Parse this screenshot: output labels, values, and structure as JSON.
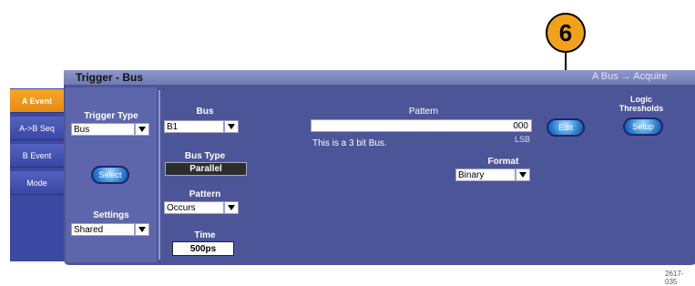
{
  "callout": {
    "number": "6"
  },
  "window": {
    "title": "Trigger - Bus",
    "right_info": "A Bus → Acquire"
  },
  "sidebar": {
    "tabs": [
      {
        "label": "A Event",
        "active": true
      },
      {
        "label": "A->B Seq",
        "active": false
      },
      {
        "label": "B Event",
        "active": false
      },
      {
        "label": "Mode",
        "active": false
      }
    ]
  },
  "trigger_type": {
    "label": "Trigger Type",
    "value": "Bus"
  },
  "select_button": {
    "label": "Select"
  },
  "settings": {
    "label": "Settings",
    "value": "Shared"
  },
  "bus": {
    "label": "Bus",
    "value": "B1"
  },
  "bus_type": {
    "label": "Bus Type",
    "value": "Parallel"
  },
  "pattern_mode": {
    "label": "Pattern",
    "value": "Occurs"
  },
  "time": {
    "label": "Time",
    "value": "500ps"
  },
  "pattern": {
    "label": "Pattern",
    "value": "000",
    "lsb": "LSB",
    "info": "This is a 3 bit Bus."
  },
  "format": {
    "label": "Format",
    "value": "Binary"
  },
  "edit_button": {
    "label": "Edit"
  },
  "logic": {
    "label_line1": "Logic",
    "label_line2": "Thresholds",
    "button": "Setup"
  },
  "figure_number": "2617-035",
  "colors": {
    "accent_orange": "#f2a21a",
    "panel": "#4c5598",
    "titlebar": "#7c86bd"
  }
}
